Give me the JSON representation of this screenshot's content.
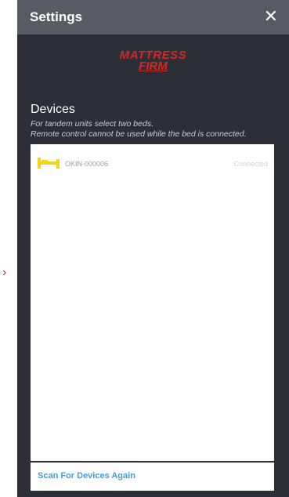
{
  "header": {
    "title": "Settings",
    "close_glyph": "✕"
  },
  "logo": {
    "line1": "MATTRESS",
    "line2": "FIRM",
    "color": "#d9271f"
  },
  "devices": {
    "title": "Devices",
    "subtitle_lines": [
      "For tandem units select two beds.",
      "Remote control cannot be used while the bed is connected."
    ],
    "items": [
      {
        "icon": "bed-icon",
        "name": "OKIN-000006",
        "status": "Connected"
      }
    ]
  },
  "scan_button_label": "Scan For Devices Again",
  "colors": {
    "panel_bg": "#2c2f38",
    "header_bg": "#565b64",
    "accent": "#3fa0d6",
    "bed_icon": "#f2d21b",
    "side_arrow": "#c0392b"
  }
}
